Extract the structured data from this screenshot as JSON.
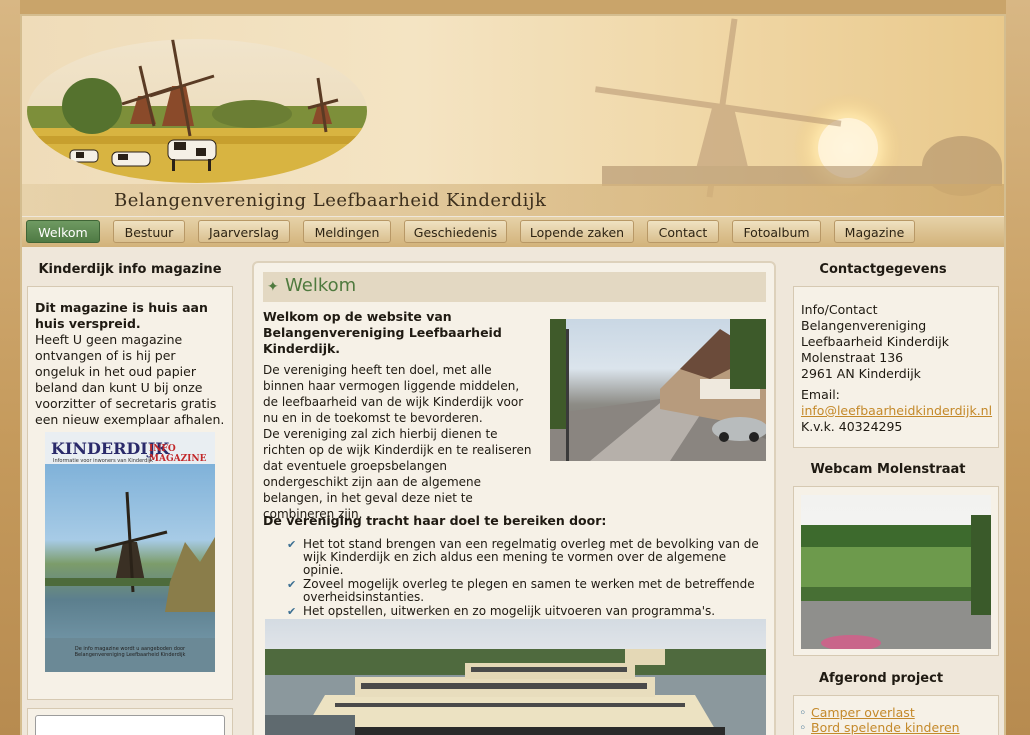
{
  "site": {
    "title": "Belangenvereniging Leefbaarheid Kinderdijk"
  },
  "nav": {
    "items": [
      "Welkom",
      "Bestuur",
      "Jaarverslag",
      "Meldingen",
      "Geschiedenis",
      "Lopende zaken",
      "Contact",
      "Fotoalbum",
      "Magazine"
    ],
    "active": "Welkom"
  },
  "left": {
    "magazine_heading": "Kinderdijk info magazine",
    "magazine_lead": "Dit magazine is huis aan huis verspreid.",
    "magazine_text": "Heeft U geen magazine ontvangen of is hij per ongeluk in het oud papier beland dan kunt U bij onze voorzitter of secretaris gratis een nieuw exemplaar afhalen.",
    "cover_title_1": "KINDERDIJK",
    "cover_title_2": "INFO MAGAZINE",
    "cover_subtitle": "Informatie voor inwoners van Kinderdijk",
    "cover_footer": "De info magazine wordt u aangeboden door Belangenvereniging Leefbaarheid Kinderdijk",
    "search_value": ""
  },
  "main": {
    "heading": "Welkom",
    "intro": "Welkom op de website van Belangenvereniging Leefbaarheid Kinderdijk.",
    "para1": "De vereniging heeft ten doel, met alle binnen haar vermogen liggende middelen, de leefbaarheid van de wijk Kinderdijk voor nu en in de toekomst te bevorderen.",
    "para2": "De vereniging zal zich hierbij dienen te richten op de wijk Kinderdijk en te realiseren dat eventuele groepsbelangen ondergeschikt zijn aan de algemene belangen, in het geval deze niet te combineren zijn.",
    "goal_heading": "De vereniging tracht haar doel te bereiken door:",
    "goals": [
      "Het tot stand brengen van een regelmatig overleg met de bevolking van de wijk Kinderdijk en zich aldus een mening te vormen over de algemene opinie.",
      "Zoveel mogelijk overleg te plegen en samen te werken met de betreffende overheidsinstanties.",
      "Het opstellen, uitwerken en zo mogelijk uitvoeren van programma's."
    ]
  },
  "right": {
    "contact_heading": "Contactgegevens",
    "contact_lines": [
      "Info/Contact",
      "Belangenvereniging",
      "Leefbaarheid Kinderdijk",
      "Molenstraat 136",
      "2961 AN Kinderdijk"
    ],
    "email_label": "Email:",
    "email": "info@leefbaarheidkinderdijk.nl",
    "kvk": "K.v.k. 40324295",
    "webcam_heading": "Webcam Molenstraat",
    "project_heading": "Afgerond project",
    "projects": [
      "Camper overlast",
      "Bord spelende kinderen"
    ]
  },
  "colors": {
    "accent_green": "#4f7a44",
    "link": "#c4892a",
    "page_bg": "#efe7da"
  }
}
